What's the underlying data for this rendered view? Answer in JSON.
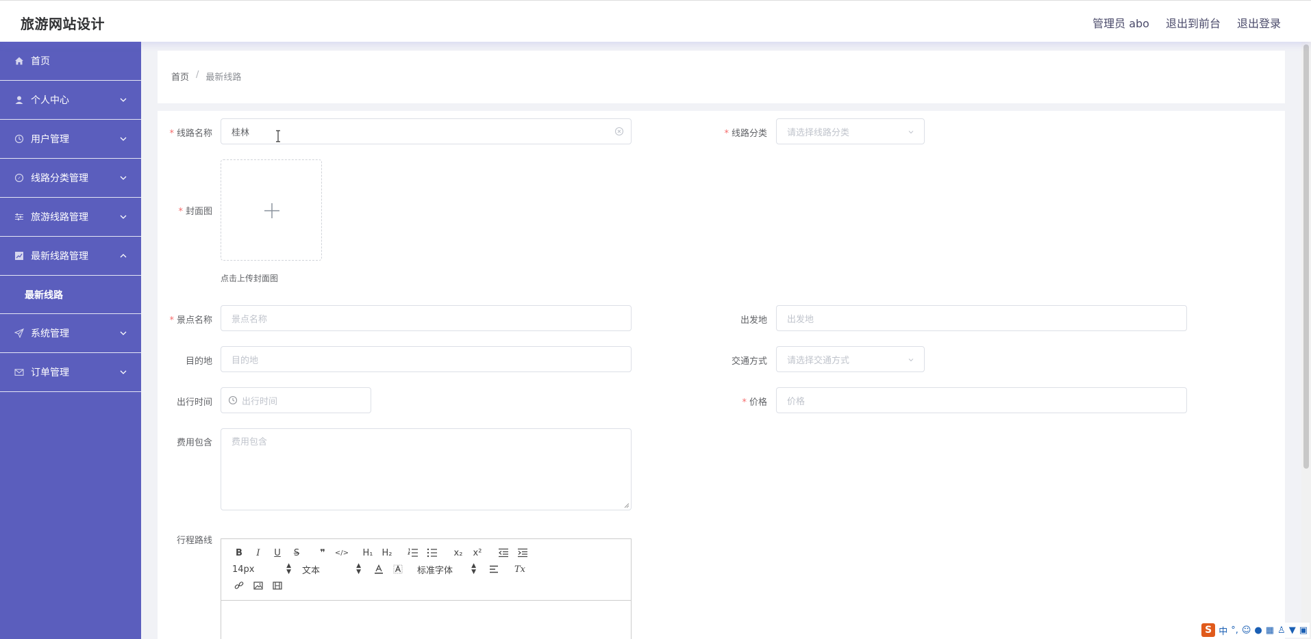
{
  "header": {
    "brand": "旅游网站设计",
    "admin_label": "管理员 abo",
    "exit_front": "退出到前台",
    "logout": "退出登录"
  },
  "sidebar": {
    "items": [
      {
        "label": "首页",
        "icon": "home-icon"
      },
      {
        "label": "个人中心",
        "icon": "user-icon"
      },
      {
        "label": "用户管理",
        "icon": "clock-icon"
      },
      {
        "label": "线路分类管理",
        "icon": "compass-icon"
      },
      {
        "label": "旅游线路管理",
        "icon": "sliders-icon"
      },
      {
        "label": "最新线路管理",
        "icon": "chart-icon"
      },
      {
        "label": "最新线路",
        "icon": ""
      },
      {
        "label": "系统管理",
        "icon": "send-icon"
      },
      {
        "label": "订单管理",
        "icon": "mail-icon"
      }
    ]
  },
  "breadcrumb": {
    "home": "首页",
    "sep": "/",
    "current": "最新线路"
  },
  "form": {
    "route_name_label": "线路名称",
    "route_name_value": "桂林",
    "route_category_label": "线路分类",
    "route_category_placeholder": "请选择线路分类",
    "cover_label": "封面图",
    "cover_tip": "点击上传封面图",
    "scenic_label": "景点名称",
    "scenic_placeholder": "景点名称",
    "departure_label": "出发地",
    "departure_placeholder": "出发地",
    "destination_label": "目的地",
    "destination_placeholder": "目的地",
    "transport_label": "交通方式",
    "transport_placeholder": "请选择交通方式",
    "time_label": "出行时间",
    "time_placeholder": "出行时间",
    "price_label": "价格",
    "price_placeholder": "价格",
    "fee_label": "费用包含",
    "fee_placeholder": "费用包含",
    "itinerary_label": "行程路线",
    "required_mark": "*"
  },
  "editor": {
    "font_size": "14px",
    "text_type": "文本",
    "font_family": "标准字体",
    "btn_bold": "B",
    "btn_italic": "I",
    "btn_underline": "U",
    "btn_strike": "S",
    "btn_quote": "❞",
    "btn_code": "</>",
    "btn_h1": "H₁",
    "btn_h2": "H₂",
    "btn_sub": "x₂",
    "btn_sup": "x²",
    "btn_clear": "Tx"
  },
  "ime": {
    "logo": "S",
    "mode": "中"
  },
  "colors": {
    "sidebar_bg": "#5b5ebd",
    "page_bg": "#f1f2f6",
    "required": "#f56c6c"
  }
}
